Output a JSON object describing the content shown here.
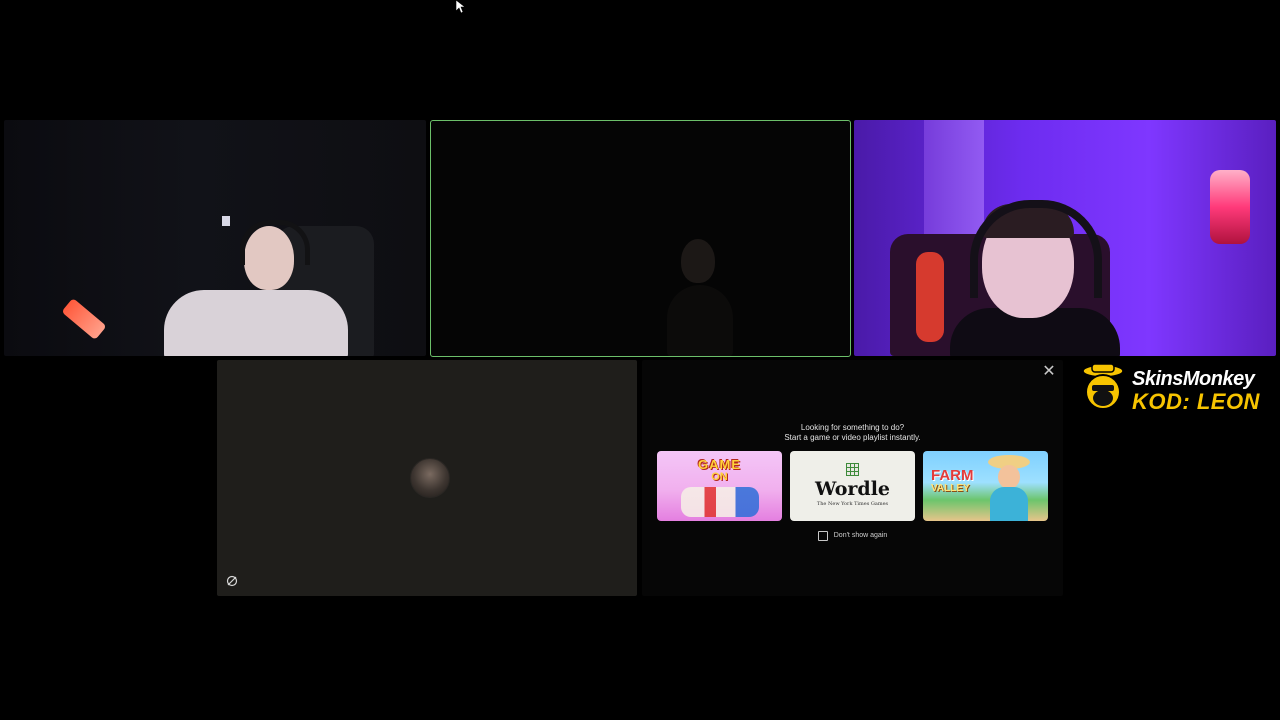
{
  "call": {
    "participants": [
      {
        "id": "participant-1"
      },
      {
        "id": "participant-2",
        "speaking": true
      },
      {
        "id": "participant-3"
      },
      {
        "id": "participant-4",
        "camera_off": true
      }
    ]
  },
  "activity_prompt": {
    "title": "Looking for something to do?",
    "subtitle": "Start a game or video playlist instantly.",
    "close_icon": "close-icon",
    "activities": [
      {
        "title": "GAME",
        "subtitle": "ON"
      },
      {
        "title": "Wordle",
        "subtitle": "The New York Times Games"
      },
      {
        "title": "FARM",
        "subtitle": "VALLEY"
      }
    ],
    "dont_show_again_label": "Don't show again",
    "dont_show_again_checked": false
  },
  "sponsor": {
    "line1": "SkinsMonkey",
    "line2": "KOD: LEON"
  },
  "colors": {
    "speaking_border": "#6cbf6a",
    "sponsor_yellow": "#f7c400"
  }
}
